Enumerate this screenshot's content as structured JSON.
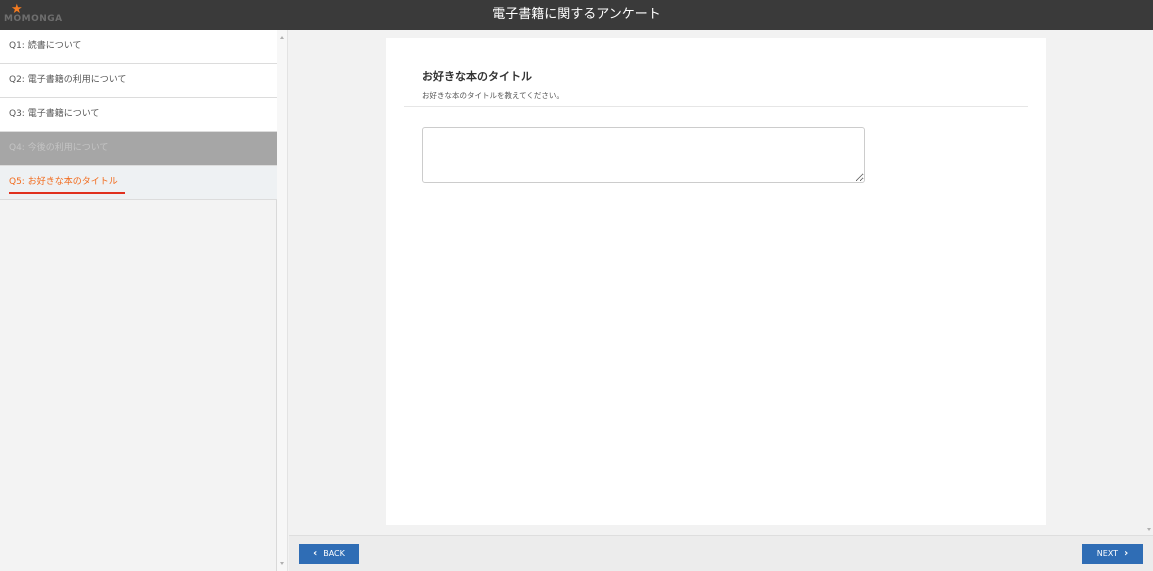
{
  "header": {
    "logo_text": "MOMONGA",
    "title": "電子書籍に関するアンケート"
  },
  "sidebar": {
    "items": [
      {
        "label": "Q1: 読書について",
        "state": "normal"
      },
      {
        "label": "Q2: 電子書籍の利用について",
        "state": "normal"
      },
      {
        "label": "Q3: 電子書籍について",
        "state": "normal"
      },
      {
        "label": "Q4: 今後の利用について",
        "state": "disabled"
      },
      {
        "label": "Q5: お好きな本のタイトル",
        "state": "active"
      }
    ]
  },
  "question": {
    "title": "お好きな本のタイトル",
    "subtitle": "お好きな本のタイトルを教えてください。",
    "answer_value": ""
  },
  "footer": {
    "back_label": "BACK",
    "next_label": "NEXT"
  },
  "colors": {
    "header_bg": "#3a3a3a",
    "accent_orange": "#f26a1b",
    "active_underline": "#e0301e",
    "button_blue": "#2f6db5",
    "disabled_bg": "#a6a6a6"
  },
  "icons": {
    "logo": "star-icon",
    "back": "chevron-left-icon",
    "next": "chevron-right-icon"
  }
}
